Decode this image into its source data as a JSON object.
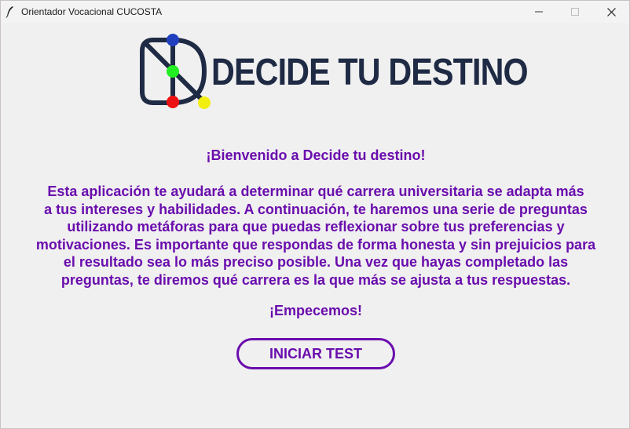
{
  "window": {
    "title": "Orientador Vocacional CUCOSTA",
    "icons": [
      "feather-icon",
      "minimize-icon",
      "maximize-icon",
      "close-icon"
    ]
  },
  "logo": {
    "text": "DECIDE TU DESTINO",
    "colors": {
      "outline": "#1f2a44",
      "blue": "#1f3fbf",
      "green": "#22ee22",
      "red": "#ee1111",
      "yellow": "#f2ee10"
    }
  },
  "content": {
    "welcome": "¡Bienvenido a Decide tu destino!",
    "description_lines": [
      "Esta aplicación te ayudará a determinar qué carrera universitaria se adapta más",
      "a tus intereses y habilidades. A continuación, te haremos una serie de preguntas",
      "utilizando metáforas para que puedas reflexionar sobre tus preferencias y",
      "motivaciones. Es importante que respondas de forma honesta y sin prejuicios para",
      "el resultado sea lo más preciso posible. Una vez que hayas completado las",
      "preguntas, te diremos qué carrera es la que más se ajusta a tus respuestas."
    ],
    "start": "¡Empecemos!",
    "button_label": "INICIAR TEST"
  },
  "theme": {
    "accent": "#6a0dad",
    "background": "#f0f0f0"
  }
}
